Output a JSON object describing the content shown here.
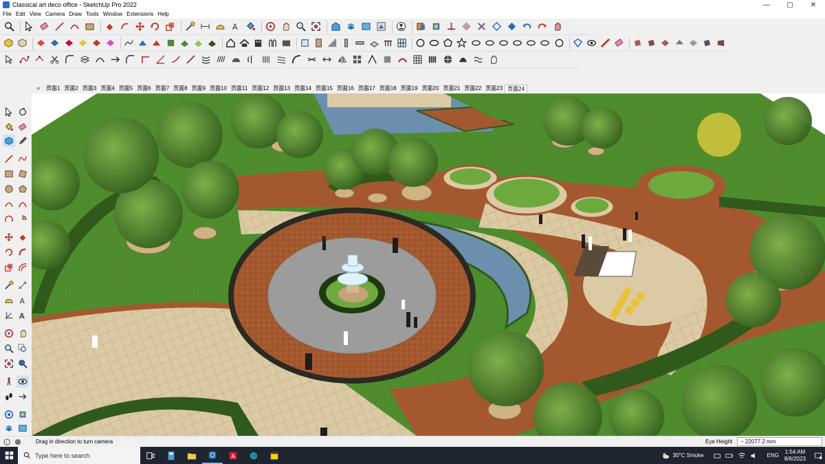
{
  "window": {
    "title": "Classical art deco office - SketchUp Pro 2022",
    "minimize": "—",
    "maximize": "▢",
    "close": "✕"
  },
  "menu": [
    "File",
    "Edit",
    "View",
    "Camera",
    "Draw",
    "Tools",
    "Window",
    "Extensions",
    "Help"
  ],
  "scene_tabs": [
    "页面1",
    "页面2",
    "页面3",
    "页面4",
    "页面5",
    "页面6",
    "页面7",
    "页面8",
    "页面9",
    "页面10",
    "页面11",
    "页面12",
    "页面13",
    "页面14",
    "页面15",
    "页面16",
    "页面17",
    "页面18",
    "页面19",
    "页面20",
    "页面21",
    "页面22",
    "页面23",
    "页面24"
  ],
  "active_scene_index": 23,
  "status": {
    "message": "Drag in direction to turn camera",
    "vcb_label": "Eye Height",
    "vcb_value": "~ 22077.2 mm"
  },
  "taskbar": {
    "search_placeholder": "Type here to search",
    "weather": "30°C  Smoke",
    "language": "ENG",
    "time": "1:54 AM",
    "date": "8/6/2023"
  },
  "colors": {
    "grass": "#4e8a2c",
    "hedge": "#2f5a1c",
    "paving": "#d9c8a6",
    "brick": "#a0552e",
    "water": "#6d8fae",
    "plaza": "#9a9a9a"
  }
}
